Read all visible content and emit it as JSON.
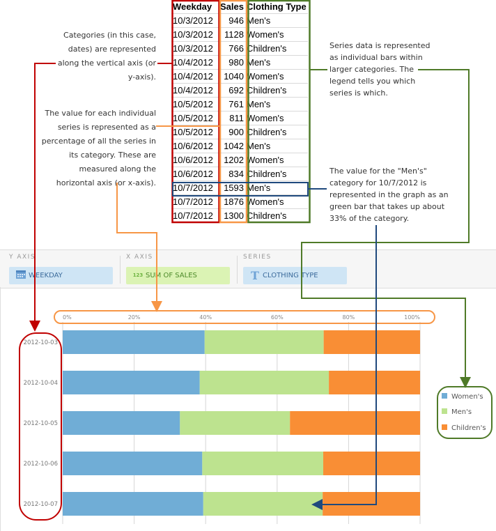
{
  "annotations": {
    "categories_note": [
      "Categories (in this case,",
      "dates) are represented",
      "along the vertical axis (or",
      "y-axis)."
    ],
    "value_note": [
      "The value for each individual",
      "series is represented as a",
      "percentage of all the series in",
      "its category. These are",
      "measured along the",
      "horizontal axis (or x-axis)."
    ],
    "series_note": [
      "Series data is represented",
      "as individual bars within",
      "larger categories. The",
      "legend tells you which",
      "series is which."
    ],
    "mens_note": [
      "The value for the \"Men's\"",
      "category for 10/7/2012 is",
      "represented in the graph as an",
      "green bar that takes up about",
      "33% of the category."
    ]
  },
  "colors": {
    "red_callout": "#c00000",
    "orange_callout": "#f79646",
    "green_callout": "#4f7a28",
    "blue_callout": "#1f497d",
    "womens": "#70add6",
    "mens": "#bde38f",
    "childrens": "#f98e35"
  },
  "spreadsheet": {
    "headers": [
      "Weekday",
      "Sales",
      "Clothing Type"
    ],
    "rows": [
      [
        "10/3/2012",
        "946",
        "Men's"
      ],
      [
        "10/3/2012",
        "1128",
        "Women's"
      ],
      [
        "10/3/2012",
        "766",
        "Children's"
      ],
      [
        "10/4/2012",
        "980",
        "Men's"
      ],
      [
        "10/4/2012",
        "1040",
        "Women's"
      ],
      [
        "10/4/2012",
        "692",
        "Children's"
      ],
      [
        "10/5/2012",
        "761",
        "Men's"
      ],
      [
        "10/5/2012",
        "811",
        "Women's"
      ],
      [
        "10/5/2012",
        "900",
        "Children's"
      ],
      [
        "10/6/2012",
        "1042",
        "Men's"
      ],
      [
        "10/6/2012",
        "1202",
        "Women's"
      ],
      [
        "10/6/2012",
        "834",
        "Children's"
      ],
      [
        "10/7/2012",
        "1593",
        "Men's"
      ],
      [
        "10/7/2012",
        "1876",
        "Women's"
      ],
      [
        "10/7/2012",
        "1300",
        "Children's"
      ]
    ],
    "highlighted_row": 12
  },
  "fields": {
    "y_axis": {
      "label": "Y AXIS",
      "value": "WEEKDAY",
      "icon": "calendar-icon"
    },
    "x_axis": {
      "label": "X AXIS",
      "value": "SUM OF SALES",
      "icon": "numeric-123-icon",
      "icon_text": "123"
    },
    "series": {
      "label": "SERIES",
      "value": "CLOTHING TYPE",
      "icon": "text-T-icon",
      "icon_text": "T"
    }
  },
  "chart_data": {
    "type": "bar",
    "orientation": "horizontal",
    "stacking": "percent",
    "categories": [
      "2012-10-03",
      "2012-10-04",
      "2012-10-05",
      "2012-10-06",
      "2012-10-07"
    ],
    "series": [
      {
        "name": "Women's",
        "values": [
          1128,
          1040,
          811,
          1202,
          1876
        ],
        "percent": [
          39.7,
          38.3,
          32.8,
          39.1,
          39.3
        ]
      },
      {
        "name": "Men's",
        "values": [
          946,
          980,
          761,
          1042,
          1593
        ],
        "percent": [
          33.3,
          36.1,
          30.8,
          33.9,
          33.4
        ]
      },
      {
        "name": "Children's",
        "values": [
          766,
          692,
          900,
          834,
          1300
        ],
        "percent": [
          27.0,
          25.5,
          36.4,
          27.1,
          27.3
        ]
      }
    ],
    "x_ticks": [
      "0%",
      "20%",
      "40%",
      "60%",
      "80%",
      "100%"
    ],
    "xlim": [
      0,
      100
    ],
    "title": "",
    "xlabel": "",
    "ylabel": "",
    "grid": "vertical",
    "legend": {
      "placement": "right",
      "entries": [
        "Women's",
        "Men's",
        "Children's"
      ]
    }
  }
}
